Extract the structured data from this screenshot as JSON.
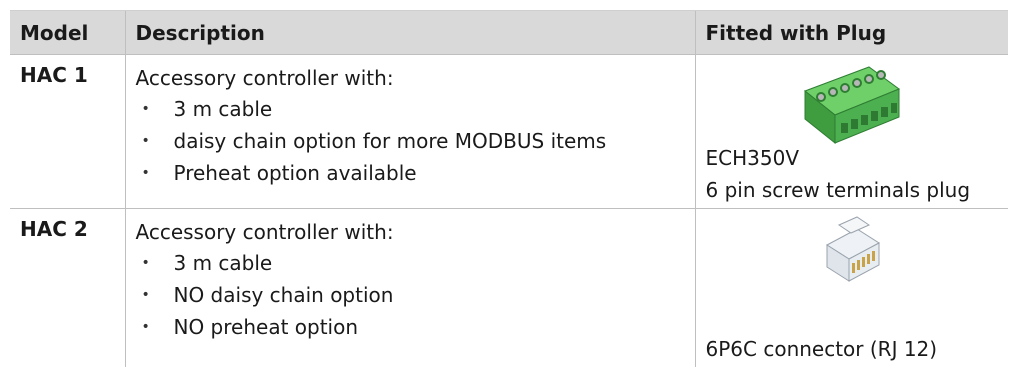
{
  "header": {
    "model": "Model",
    "description": "Description",
    "plug": "Fitted with Plug"
  },
  "rows": [
    {
      "model": "HAC 1",
      "lead": "Accessory controller with:",
      "bullets": [
        "3 m cable",
        "daisy chain option for more MODBUS items",
        "Preheat option available"
      ],
      "plug_lines": [
        "ECH350V",
        "6 pin screw terminals plug"
      ],
      "plug_image": "green-screw-terminal-plug-image"
    },
    {
      "model": "HAC 2",
      "lead": "Accessory controller with:",
      "bullets": [
        "3 m cable",
        "NO daisy chain option",
        "NO preheat option"
      ],
      "plug_lines": [
        "6P6C connector (RJ 12)"
      ],
      "plug_image": "rj12-connector-image"
    }
  ],
  "bullet_glyph": "•",
  "colors": {
    "header_bg": "#d9d9d9",
    "terminal_green": "#4caf50",
    "rule": "#bfbfbf"
  }
}
